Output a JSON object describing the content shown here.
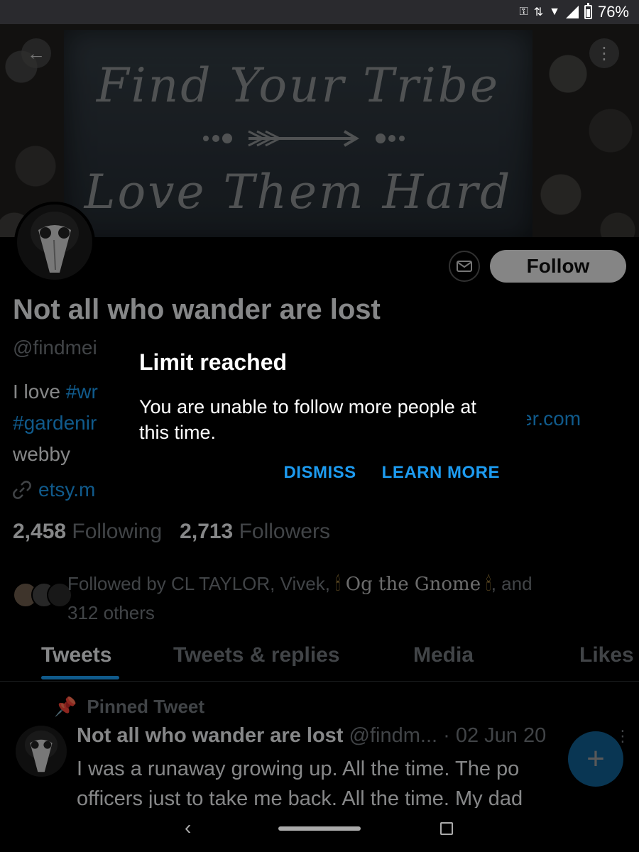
{
  "status_bar": {
    "battery": "76%"
  },
  "banner": {
    "line1": "Find Your Tribe",
    "line2": "Love Them Hard"
  },
  "profile": {
    "name": "Not all who wander are lost",
    "handle": "@findmei",
    "bio_line1_prefix": "I love ",
    "bio_line1_tag": "#wr",
    "bio_line2_tag": "#gardenir",
    "bio_line3": "webby",
    "bio_right_link": "er.com",
    "link": "etsy.m",
    "follow_label": "Follow",
    "following_count": "2,458",
    "following_label": "Following",
    "followers_count": "2,713",
    "followers_label": "Followers",
    "followed_by_prefix": "Followed by CL TAYLOR, Vivek,",
    "followed_by_gnome": "Og the Gnome",
    "followed_by_suffix": ", and",
    "followed_by_others": "312 others"
  },
  "tabs": [
    {
      "label": "Tweets"
    },
    {
      "label": "Tweets & replies"
    },
    {
      "label": "Media"
    },
    {
      "label": "Likes"
    }
  ],
  "pinned": {
    "label": "Pinned Tweet",
    "author": "Not all who wander are lost",
    "handle": "@findm...",
    "date": "· 02 Jun 20",
    "text_line1": "I was a runaway growing up. All the time. The po",
    "text_line2": "officers just to take me back. All the time. My dad"
  },
  "dialog": {
    "title": "Limit reached",
    "message": "You are unable to follow more people at this time.",
    "dismiss": "DISMISS",
    "learn_more": "LEARN MORE"
  },
  "colors": {
    "accent": "#1d9bf0",
    "background": "#000000",
    "muted": "#71767b"
  }
}
